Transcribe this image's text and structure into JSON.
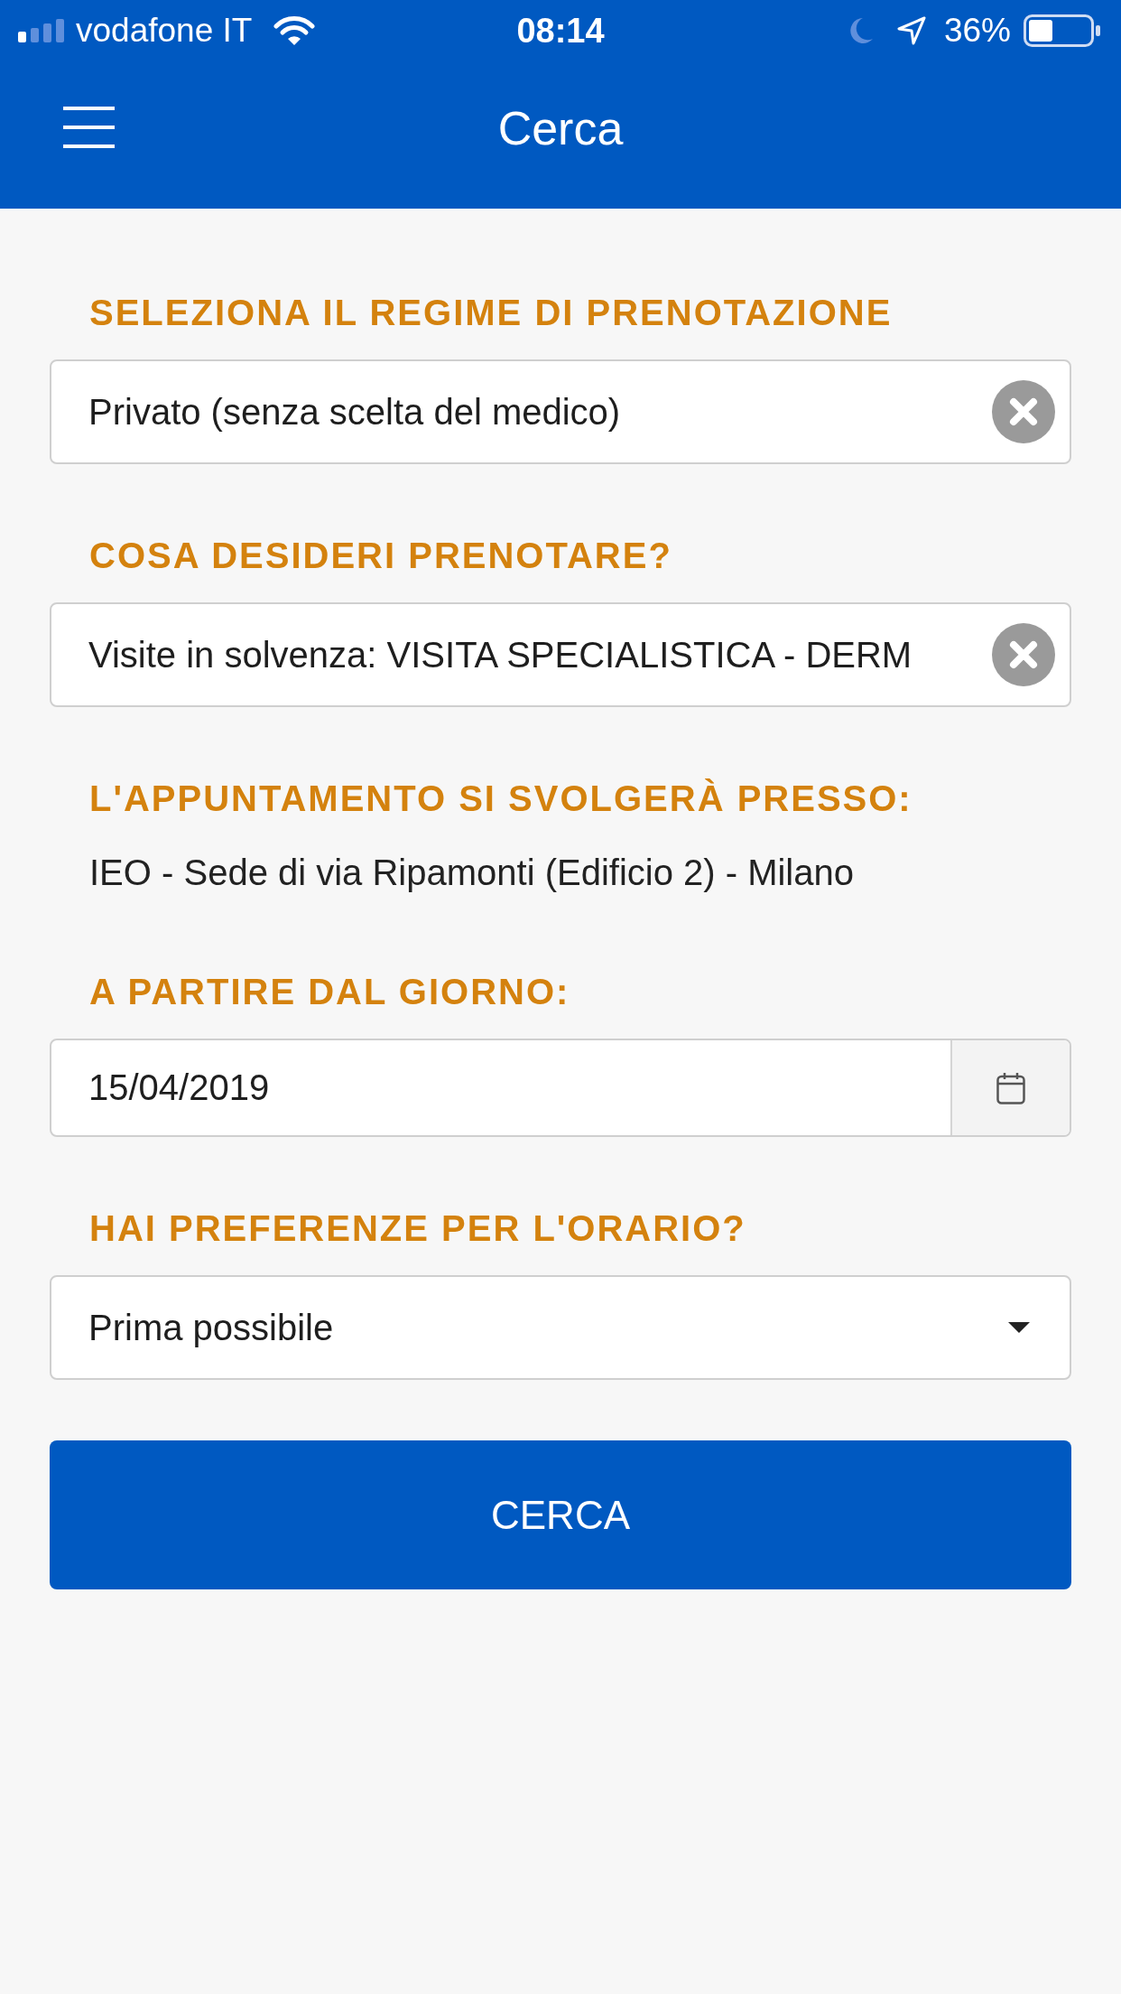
{
  "status_bar": {
    "carrier": "vodafone IT",
    "time": "08:14",
    "battery": "36%"
  },
  "header": {
    "title": "Cerca"
  },
  "form": {
    "fields": [
      {
        "kind": "clearable",
        "label": "SELEZIONA IL REGIME DI PRENOTAZIONE",
        "value": "Privato (senza scelta del medico)"
      },
      {
        "kind": "clearable",
        "label": "COSA DESIDERI PRENOTARE?",
        "value": "Visite in solvenza: VISITA SPECIALISTICA - DERM"
      },
      {
        "kind": "info",
        "label": "L'APPUNTAMENTO SI SVOLGERÀ PRESSO:",
        "value": "IEO - Sede di via Ripamonti (Edificio 2) - Milano"
      },
      {
        "kind": "date",
        "label": "A PARTIRE DAL GIORNO:",
        "value": "15/04/2019"
      },
      {
        "kind": "select",
        "label": "HAI PREFERENZE PER L'ORARIO?",
        "value": "Prima possibile"
      }
    ]
  },
  "search_button": "CERCA"
}
